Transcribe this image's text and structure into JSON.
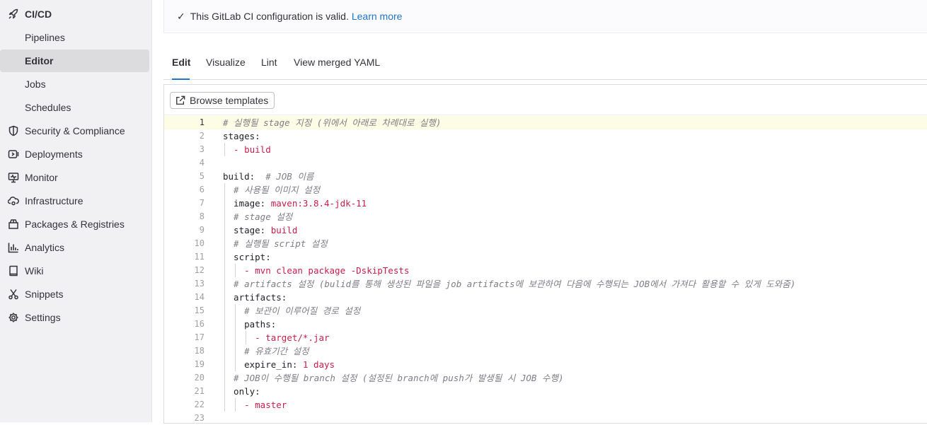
{
  "sidebar": {
    "header": {
      "label": "CI/CD",
      "icon": "rocket-icon"
    },
    "cicd_items": [
      {
        "label": "Pipelines"
      },
      {
        "label": "Editor",
        "active": true
      },
      {
        "label": "Jobs"
      },
      {
        "label": "Schedules"
      }
    ],
    "items": [
      {
        "label": "Security & Compliance",
        "icon": "shield-icon"
      },
      {
        "label": "Deployments",
        "icon": "deployments-icon"
      },
      {
        "label": "Monitor",
        "icon": "monitor-icon"
      },
      {
        "label": "Infrastructure",
        "icon": "cloud-gear-icon"
      },
      {
        "label": "Packages & Registries",
        "icon": "package-icon"
      },
      {
        "label": "Analytics",
        "icon": "chart-icon"
      },
      {
        "label": "Wiki",
        "icon": "book-icon"
      },
      {
        "label": "Snippets",
        "icon": "scissors-icon"
      },
      {
        "label": "Settings",
        "icon": "gear-icon"
      }
    ]
  },
  "alert": {
    "icon": "check-icon",
    "message": "This GitLab CI configuration is valid.",
    "link": "Learn more"
  },
  "tabs": [
    {
      "label": "Edit",
      "active": true
    },
    {
      "label": "Visualize"
    },
    {
      "label": "Lint"
    },
    {
      "label": "View merged YAML"
    }
  ],
  "editor": {
    "browse_label": "Browse templates",
    "current_line": 1,
    "lines": [
      [
        [
          "# 실행될 stage 지정 (위에서 아래로 차례대로 실행)",
          "comment"
        ]
      ],
      [
        [
          "stages:",
          "key"
        ]
      ],
      [
        [
          "- build",
          "val"
        ]
      ],
      [],
      [
        [
          "build:",
          "key"
        ],
        [
          "  # JOB 이름",
          "comment"
        ]
      ],
      [
        [
          "# 사용될 이미지 설정",
          "comment"
        ]
      ],
      [
        [
          "image: ",
          "key"
        ],
        [
          "maven:3.8.4-jdk-11",
          "val"
        ]
      ],
      [
        [
          "# stage 설정",
          "comment"
        ]
      ],
      [
        [
          "stage: ",
          "key"
        ],
        [
          "build",
          "val"
        ]
      ],
      [
        [
          "# 실행될 script 설정",
          "comment"
        ]
      ],
      [
        [
          "script:",
          "key"
        ]
      ],
      [
        [
          "- mvn clean package -DskipTests",
          "val"
        ]
      ],
      [
        [
          "# artifacts 설정 (bulid를 통해 생성된 파일을 job artifacts에 보관하여 다음에 수행되는 JOB에서 가져다 활용할 수 있게 도와줌)",
          "comment"
        ]
      ],
      [
        [
          "artifacts:",
          "key"
        ]
      ],
      [
        [
          "# 보관이 이루어질 경로 설정",
          "comment"
        ]
      ],
      [
        [
          "paths:",
          "key"
        ]
      ],
      [
        [
          "- target/*.jar",
          "val"
        ]
      ],
      [
        [
          "# 유효기간 설정",
          "comment"
        ]
      ],
      [
        [
          "expire_in: ",
          "key"
        ],
        [
          "1 days",
          "val"
        ]
      ],
      [
        [
          "# JOB이 수행될 branch 설정 (설정된 branch에 push가 발생될 시 JOB 수행)",
          "comment"
        ]
      ],
      [
        [
          "only:",
          "key"
        ]
      ],
      [
        [
          "- master",
          "val"
        ]
      ],
      []
    ]
  }
}
